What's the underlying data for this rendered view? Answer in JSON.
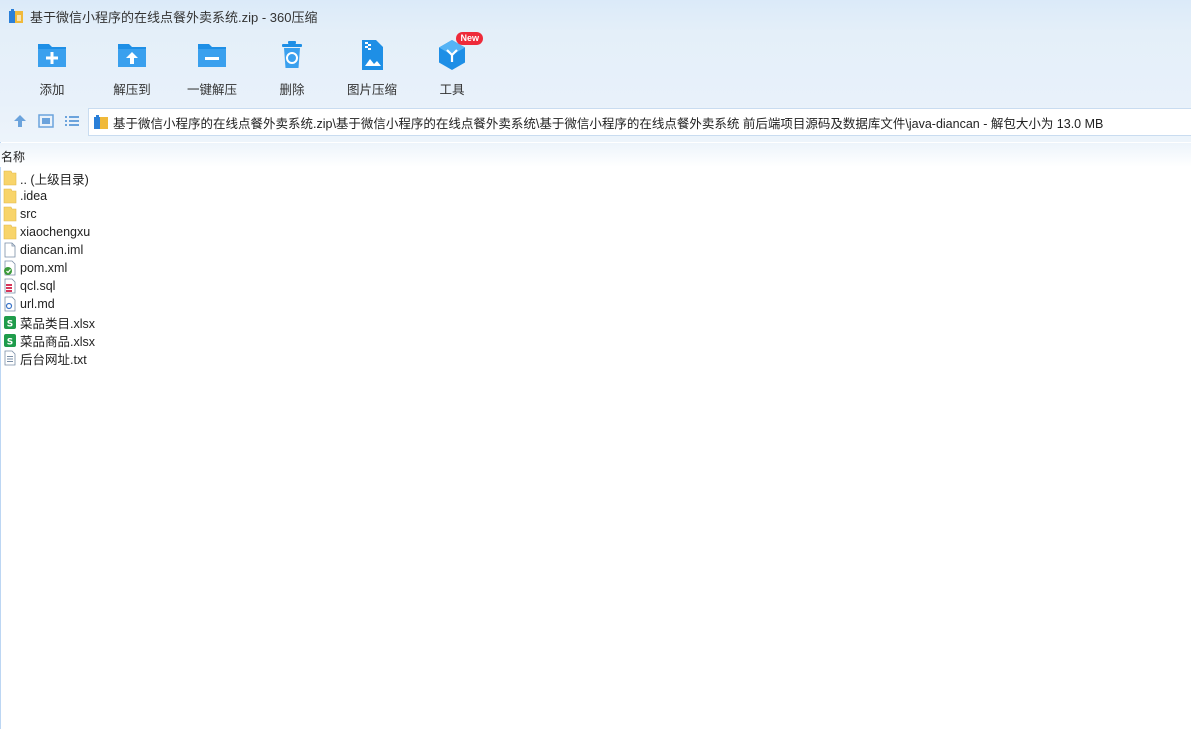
{
  "window": {
    "title": "基于微信小程序的在线点餐外卖系统.zip - 360压缩"
  },
  "toolbar": {
    "items": [
      {
        "label": "添加",
        "icon": "folder-add-icon"
      },
      {
        "label": "解压到",
        "icon": "folder-extract-icon"
      },
      {
        "label": "一键解压",
        "icon": "folder-oneclick-icon"
      },
      {
        "label": "删除",
        "icon": "recycle-bin-icon"
      },
      {
        "label": "图片压缩",
        "icon": "image-compress-icon"
      },
      {
        "label": "工具",
        "icon": "tools-cube-icon",
        "badge": "New"
      }
    ]
  },
  "address": {
    "path": "基于微信小程序的在线点餐外卖系统.zip\\基于微信小程序的在线点餐外卖系统\\基于微信小程序的在线点餐外卖系统 前后端项目源码及数据库文件\\java-diancan - 解包大小为 13.0 MB"
  },
  "columns": {
    "name": "名称"
  },
  "files": [
    {
      "name": ".. (上级目录)",
      "type": "folder"
    },
    {
      "name": ".idea",
      "type": "folder"
    },
    {
      "name": "src",
      "type": "folder"
    },
    {
      "name": "xiaochengxu",
      "type": "folder"
    },
    {
      "name": "diancan.iml",
      "type": "file"
    },
    {
      "name": "pom.xml",
      "type": "xml"
    },
    {
      "name": "qcl.sql",
      "type": "sql"
    },
    {
      "name": "url.md",
      "type": "md"
    },
    {
      "name": "菜品类目.xlsx",
      "type": "xlsx"
    },
    {
      "name": "菜品商品.xlsx",
      "type": "xlsx"
    },
    {
      "name": "后台网址.txt",
      "type": "txt"
    }
  ],
  "colors": {
    "accent": "#1e8fe6",
    "folder": "#f8d46a",
    "badge": "#ee2a3a"
  }
}
